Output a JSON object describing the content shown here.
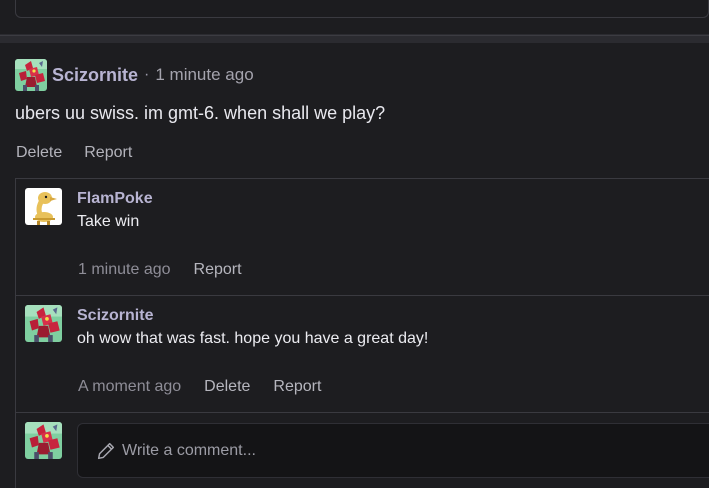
{
  "post": {
    "author": "Scizornite",
    "separator": "·",
    "time": "1 minute ago",
    "body": "ubers uu swiss. im gmt-6. when shall we play?",
    "actions": [
      "Delete",
      "Report"
    ]
  },
  "comments": [
    {
      "author": "FlamPoke",
      "text": "Take win",
      "time": "1 minute ago",
      "actions": [
        "Report"
      ],
      "avatar_icon": "bird-pokemon-avatar-icon"
    },
    {
      "author": "Scizornite",
      "text": "oh wow that was fast. hope you have a great day!",
      "time": "A moment ago",
      "actions": [
        "Delete",
        "Report"
      ],
      "avatar_icon": "scizor-pokemon-avatar-icon"
    }
  ],
  "composer": {
    "placeholder": "Write a comment...",
    "icon": "pencil-icon"
  },
  "colors": {
    "background": "#1d1d20",
    "username": "#b8b4d2",
    "body_text": "#e8e8ee",
    "muted_text": "#a4a3ad",
    "border": "#3a3a40"
  }
}
